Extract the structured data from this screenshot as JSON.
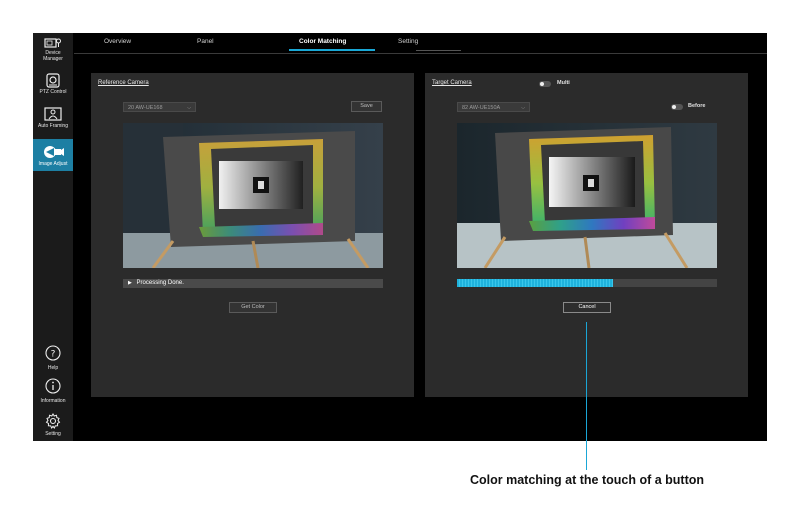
{
  "sidebar": {
    "items": [
      {
        "label": "Device Manager",
        "icon": "device-manager-icon"
      },
      {
        "label": "PTZ Control",
        "icon": "ptz-control-icon"
      },
      {
        "label": "Auto Framing",
        "icon": "auto-framing-icon"
      },
      {
        "label": "Image Adjust",
        "icon": "image-adjust-icon",
        "active": true
      },
      {
        "label": "Help",
        "icon": "help-icon"
      },
      {
        "label": "Information",
        "icon": "information-icon"
      },
      {
        "label": "Setting",
        "icon": "setting-icon"
      }
    ]
  },
  "tabs": [
    {
      "label": "Overview"
    },
    {
      "label": "Panel"
    },
    {
      "label": "Color Matching",
      "active": true
    },
    {
      "label": "Setting"
    }
  ],
  "reference": {
    "title": "Reference Camera",
    "camera": "20 AW-UE168",
    "save_label": "Save",
    "status": "Processing Done.",
    "get_color_label": "Get Color"
  },
  "target": {
    "title": "Target Camera",
    "multi_label": "Multi",
    "camera": "82 AW-UE150A",
    "before_label": "Before",
    "progress": 0.6,
    "cancel_label": "Cancel"
  },
  "caption": "Color matching at the touch of a button",
  "colors": {
    "accent": "#1aa6d6",
    "active_nav": "#1d7fa3",
    "panel": "#2b2b2b"
  }
}
